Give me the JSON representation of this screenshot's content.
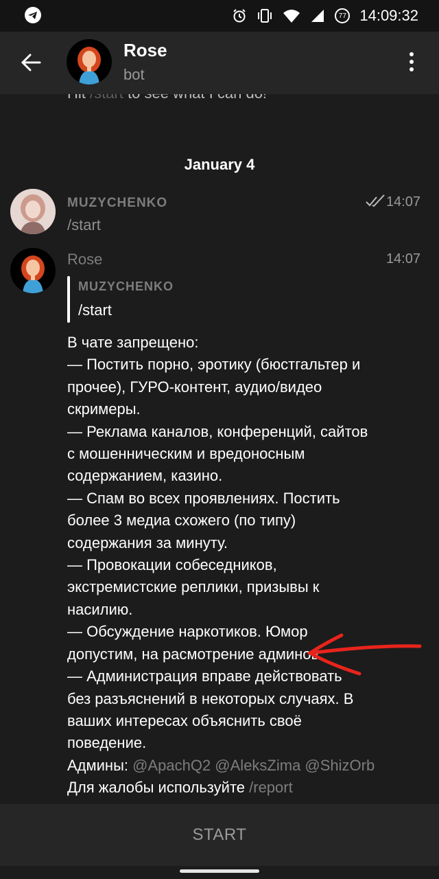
{
  "status_bar": {
    "time": "14:09:32",
    "left_icon": "telegram-icon",
    "right_icons": [
      "alarm-icon",
      "vibrate-icon",
      "wifi-icon",
      "signal-icon",
      "battery-icon"
    ],
    "battery_level": "77"
  },
  "header": {
    "title": "Rose",
    "subtitle": "bot",
    "back_icon": "arrow-left-icon",
    "menu_icon": "more-vertical-icon"
  },
  "chat": {
    "cut_prefix": "Hit ",
    "cut_command": "/start",
    "cut_suffix": " to see what I can do!",
    "date_separator": "January 4",
    "messages": [
      {
        "sender": "MUZYCHENKO",
        "time": "14:07",
        "text": "/start",
        "status": "read"
      },
      {
        "sender": "Rose",
        "time": "14:07",
        "reply_to": {
          "sender": "MUZYCHENKO",
          "text": "/start"
        },
        "lines": [
          "В чате запрещено:",
          "— Постить порно, эротику (бюстгальтер и",
          "прочее), ГУРО-контент, аудио/видео",
          "скримеры.",
          "— Реклама каналов, конференций, сайтов",
          "с мошенническим и вредоносным",
          "содержанием, казино.",
          "— Спам во всех проявлениях. Постить",
          "более 3 медиа схожего (по типу)",
          "содержания за минуту.",
          "— Провокации собеседников,",
          "экстремистские реплики, призывы к",
          "насилию.",
          "— Обсуждение наркотиков. Юмор",
          "допустим, на расмотрение админов.",
          "— Администрация вправе действовать",
          "без разъяснений в некоторых случаях. В",
          "ваших интересах объяснить своё",
          "поведение."
        ],
        "admins_label": "Админы: ",
        "admins": "@ApachQ2 @AleksZima @ShizOrb",
        "complaint_label": "Для жалобы используйте ",
        "complaint_command": "/report"
      }
    ]
  },
  "bottom": {
    "start_label": "START"
  },
  "colors": {
    "background": "#1c1c1c",
    "bars": "#262626",
    "annotation_arrow": "#e8241c",
    "muted_text": "#7d7d7d"
  }
}
